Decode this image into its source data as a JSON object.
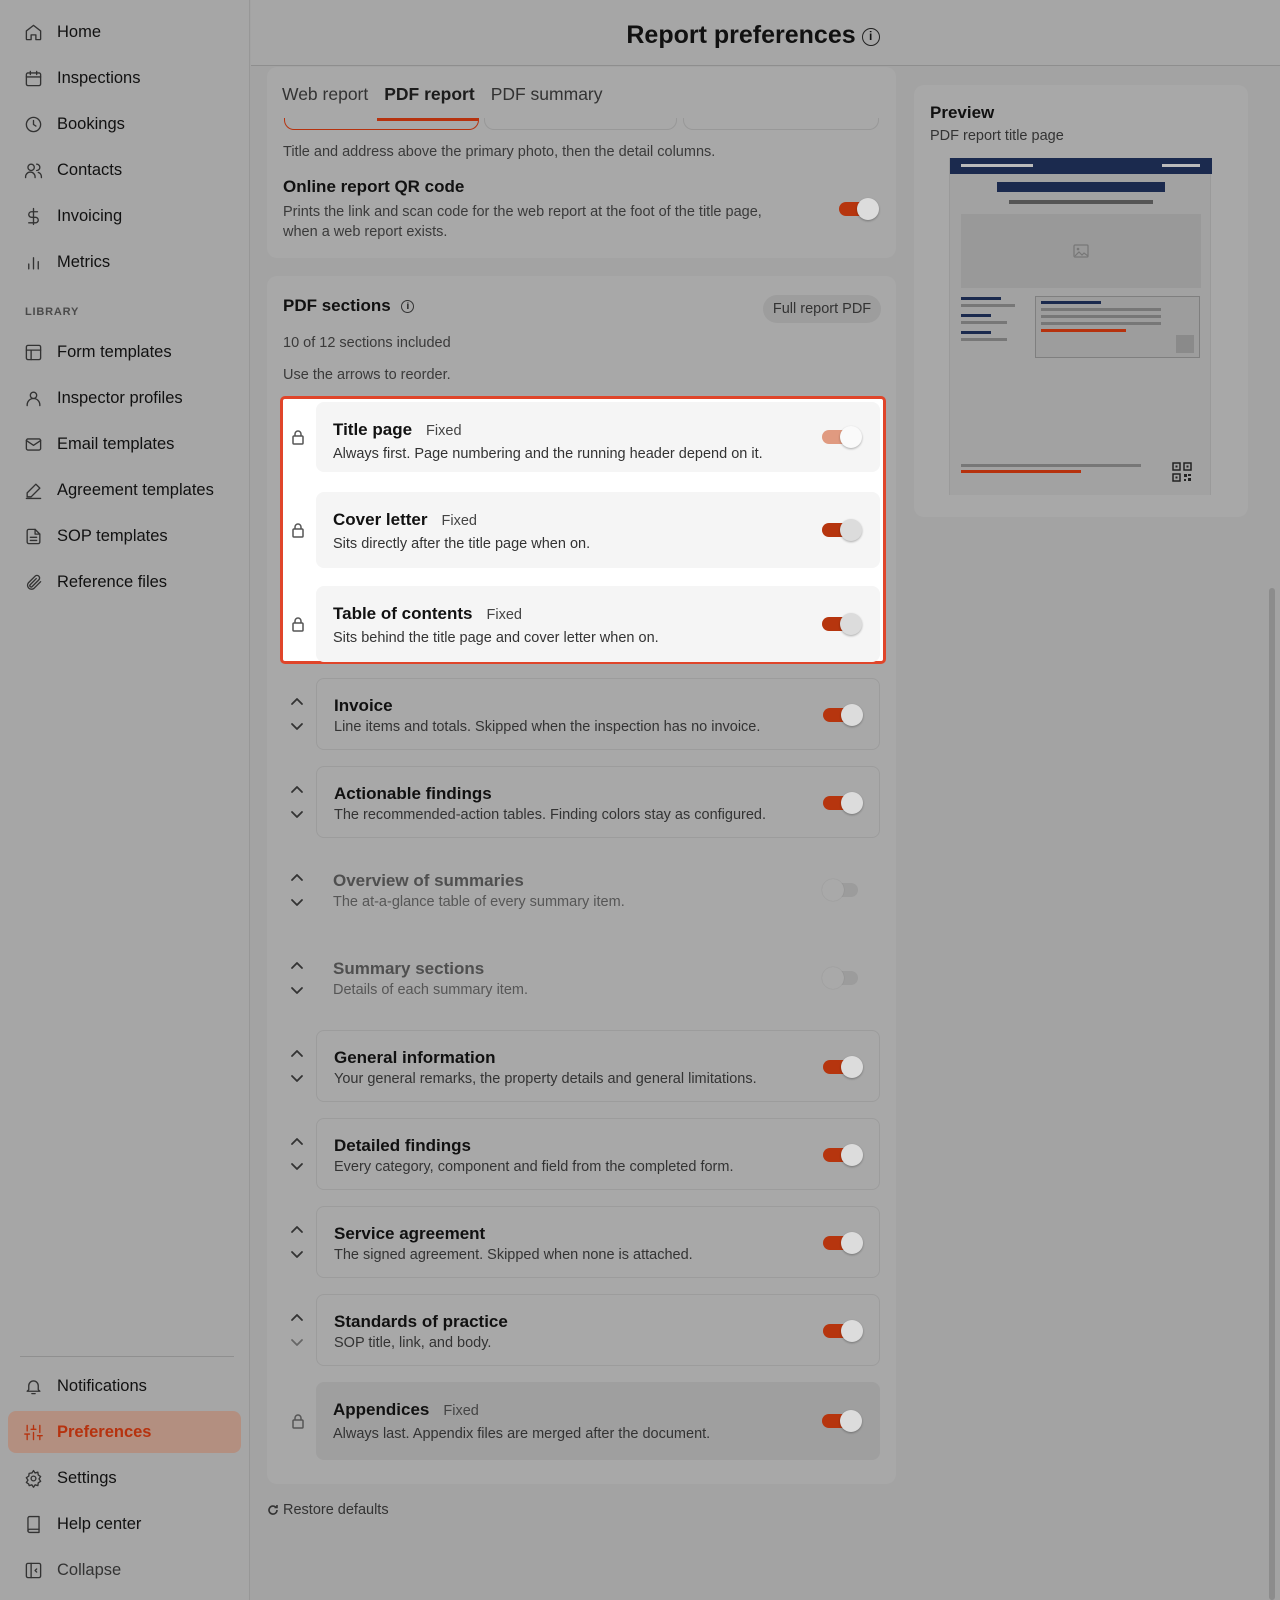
{
  "sidebar": {
    "items": [
      {
        "label": "Home",
        "icon": "home-icon"
      },
      {
        "label": "Inspections",
        "icon": "calendar-icon"
      },
      {
        "label": "Bookings",
        "icon": "clock-icon"
      },
      {
        "label": "Contacts",
        "icon": "users-icon"
      },
      {
        "label": "Invoicing",
        "icon": "dollar-icon"
      },
      {
        "label": "Metrics",
        "icon": "bar-chart-icon"
      }
    ],
    "library_label": "LIBRARY",
    "library_items": [
      {
        "label": "Form templates",
        "icon": "layout-icon"
      },
      {
        "label": "Inspector profiles",
        "icon": "user-icon"
      },
      {
        "label": "Email templates",
        "icon": "mail-icon"
      },
      {
        "label": "Agreement templates",
        "icon": "pen-icon"
      },
      {
        "label": "SOP templates",
        "icon": "file-text-icon"
      },
      {
        "label": "Reference files",
        "icon": "paperclip-icon"
      }
    ],
    "bottom_items": [
      {
        "label": "Notifications",
        "icon": "bell-icon"
      },
      {
        "label": "Preferences",
        "icon": "sliders-icon",
        "active": true
      },
      {
        "label": "Settings",
        "icon": "gear-icon"
      },
      {
        "label": "Help center",
        "icon": "book-icon"
      },
      {
        "label": "Collapse",
        "icon": "sidebar-collapse-icon"
      }
    ]
  },
  "header": {
    "title": "Report preferences"
  },
  "tabs": [
    {
      "label": "Web report"
    },
    {
      "label": "PDF report",
      "active": true
    },
    {
      "label": "PDF summary"
    }
  ],
  "title_block": {
    "layout_desc": "Title and address above the primary photo, then the detail columns.",
    "qr_title": "Online report QR code",
    "qr_desc_1": "Prints the link and scan code for the web report at the foot of the title page,",
    "qr_desc_2": "when a web report exists.",
    "qr_enabled": true
  },
  "pdf_sections": {
    "title": "PDF sections",
    "pill": "Full report PDF",
    "count_text": "10 of 12 sections included",
    "hint": "Use the arrows to reorder.",
    "fixed_label": "Fixed",
    "sections": [
      {
        "title": "Title page",
        "desc": "Always first. Page numbering and the running header depend on it.",
        "fixed": true,
        "enabled": true
      },
      {
        "title": "Cover letter",
        "desc": "Sits directly after the title page when on.",
        "fixed": true,
        "enabled": true
      },
      {
        "title": "Table of contents",
        "desc": "Sits behind the title page and cover letter when on.",
        "fixed": true,
        "enabled": true
      },
      {
        "title": "Invoice",
        "desc": "Line items and totals. Skipped when the inspection has no invoice.",
        "fixed": false,
        "enabled": true
      },
      {
        "title": "Actionable findings",
        "desc": "The recommended-action tables. Finding colors stay as configured.",
        "fixed": false,
        "enabled": true
      },
      {
        "title": "Overview of summaries",
        "desc": "The at-a-glance table of every summary item.",
        "fixed": false,
        "enabled": false
      },
      {
        "title": "Summary sections",
        "desc": "Details of each summary item.",
        "fixed": false,
        "enabled": false
      },
      {
        "title": "General information",
        "desc": "Your general remarks, the property details and general limitations.",
        "fixed": false,
        "enabled": true
      },
      {
        "title": "Detailed findings",
        "desc": "Every category, component and field from the completed form.",
        "fixed": false,
        "enabled": true
      },
      {
        "title": "Service agreement",
        "desc": "The signed agreement. Skipped when none is attached.",
        "fixed": false,
        "enabled": true
      },
      {
        "title": "Standards of practice",
        "desc": "SOP title, link, and body.",
        "fixed": false,
        "enabled": true
      },
      {
        "title": "Appendices",
        "desc": "Always last. Appendix files are merged after the document.",
        "fixed": true,
        "enabled": true
      }
    ],
    "restore_label": "Restore defaults"
  },
  "preview": {
    "title": "Preview",
    "subtitle": "PDF report title page"
  },
  "colors": {
    "accent": "#b6320e",
    "highlight_border": "#e0452a",
    "navy": "#1b2a4e"
  }
}
